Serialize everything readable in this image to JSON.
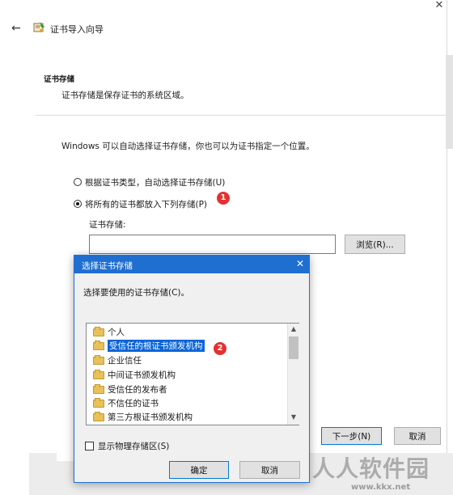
{
  "wizard": {
    "title": "证书导入向导",
    "section_title": "证书存储",
    "section_desc": "证书存储是保存证书的系统区域。",
    "intro": "Windows 可以自动选择证书存储，你也可以为证书指定一个位置。",
    "radio_auto": "根据证书类型，自动选择证书存储(U)",
    "radio_manual": "将所有的证书都放入下列存储(P)",
    "store_label": "证书存储:",
    "store_value": "",
    "browse": "浏览(R)...",
    "next": "下一步(N)",
    "cancel": "取消",
    "close_glyph": "✕",
    "back_glyph": "←"
  },
  "dialog": {
    "title": "选择证书存储",
    "prompt": "选择要使用的证书存储(C)。",
    "items": [
      "个人",
      "受信任的根证书颁发机构",
      "企业信任",
      "中间证书颁发机构",
      "受信任的发布者",
      "不信任的证书",
      "第三方根证书颁发机构"
    ],
    "selected_index": 1,
    "show_physical": "显示物理存储区(S)",
    "ok": "确定",
    "cancel": "取消",
    "close_glyph": "✕"
  },
  "badges": {
    "one": "1",
    "two": "2"
  },
  "watermark": {
    "text": "人人软件园",
    "url": "www.kkx.net"
  },
  "colors": {
    "accent": "#1f6fd1",
    "selection": "#0a64d6",
    "badge": "#e53030"
  }
}
